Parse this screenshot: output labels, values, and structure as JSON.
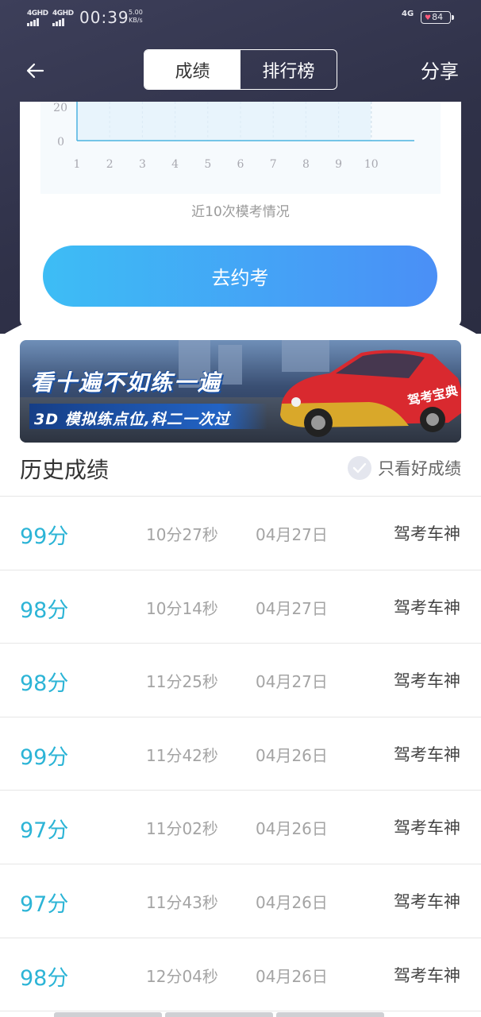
{
  "status_bar": {
    "network_1": "4GHD",
    "network_2": "4GHD",
    "time": "00:39",
    "speed_value": "5.00",
    "speed_unit": "KB/s",
    "network_right": "4G",
    "battery": "84"
  },
  "nav": {
    "tabs": [
      {
        "label": "成绩",
        "active": true
      },
      {
        "label": "排行榜",
        "active": false
      }
    ],
    "share_label": "分享"
  },
  "chart_data": {
    "type": "area",
    "title": "近10次模考情况",
    "categories": [
      "1",
      "2",
      "3",
      "4",
      "5",
      "6",
      "7",
      "8",
      "9",
      "10"
    ],
    "y_ticks_visible": [
      "20",
      "0"
    ],
    "grid": true,
    "values": [
      null,
      null,
      null,
      null,
      null,
      null,
      null,
      null,
      null,
      null
    ]
  },
  "actions": {
    "book_exam_label": "去约考"
  },
  "banner": {
    "headline": "看十遍不如练一遍",
    "subline": "3D 模拟练点位,科二一次过",
    "car_decal": "驾考宝典"
  },
  "history": {
    "title": "历史成绩",
    "filter_label": "只看好成绩",
    "records": [
      {
        "score": "99分",
        "duration": "10分27秒",
        "date": "04月27日",
        "rank_title": "驾考车神"
      },
      {
        "score": "98分",
        "duration": "10分14秒",
        "date": "04月27日",
        "rank_title": "驾考车神"
      },
      {
        "score": "98分",
        "duration": "11分25秒",
        "date": "04月27日",
        "rank_title": "驾考车神"
      },
      {
        "score": "99分",
        "duration": "11分42秒",
        "date": "04月26日",
        "rank_title": "驾考车神"
      },
      {
        "score": "97分",
        "duration": "11分02秒",
        "date": "04月26日",
        "rank_title": "驾考车神"
      },
      {
        "score": "97分",
        "duration": "11分43秒",
        "date": "04月26日",
        "rank_title": "驾考车神"
      },
      {
        "score": "98分",
        "duration": "12分04秒",
        "date": "04月26日",
        "rank_title": "驾考车神"
      }
    ]
  },
  "colors": {
    "accent": "#2cb4d6",
    "button_gradient_start": "#3dbdf5",
    "button_gradient_end": "#4a8ff6",
    "header_bg": "#2f3148"
  }
}
